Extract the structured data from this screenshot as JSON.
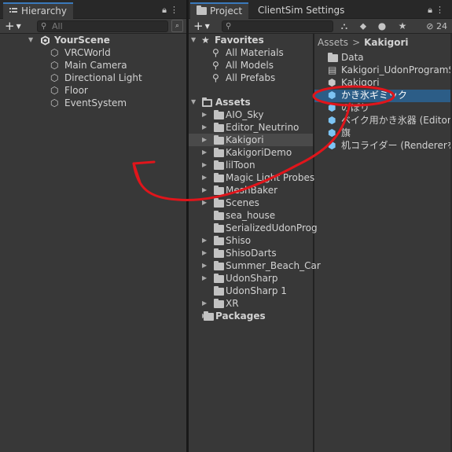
{
  "hierarchy": {
    "tab_label": "Hierarchy",
    "search_placeholder": "All",
    "scene": "YourScene",
    "objects": [
      "VRCWorld",
      "Main Camera",
      "Directional Light",
      "Floor",
      "EventSystem"
    ]
  },
  "project": {
    "tabs": [
      "Project",
      "ClientSim Settings"
    ],
    "hidden_count": "24",
    "favorites": {
      "label": "Favorites",
      "items": [
        "All Materials",
        "All Models",
        "All Prefabs"
      ]
    },
    "assets_label": "Assets",
    "asset_folders": [
      "AIO_Sky",
      "Editor_Neutrino",
      "Kakigori",
      "KakigoriDemo",
      "lilToon",
      "Magic Light Probes",
      "MeshBaker",
      "Scenes",
      "sea_house",
      "SerializedUdonProg",
      "Shiso",
      "ShisoDarts",
      "Summer_Beach_Car",
      "UdonSharp",
      "UdonSharp 1",
      "XR"
    ],
    "packages_label": "Packages",
    "breadcrumb": [
      "Assets",
      "Kakigori"
    ],
    "files": [
      "Data",
      "Kakigori_UdonProgramSo",
      "Kakigori",
      "かき氷ギミック",
      "のぼり",
      "ベイク用かき氷器 (EditorOnl",
      "旗",
      "机コライダー (Rendererを無効"
    ]
  },
  "colors": {
    "selection": "#2c5d87",
    "annotation": "#e0151b",
    "accent": "#3a79bb",
    "prefab_icon": "#7cc4f4"
  }
}
